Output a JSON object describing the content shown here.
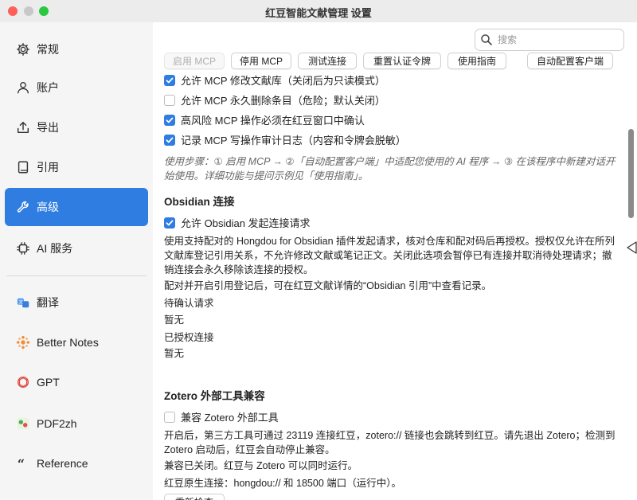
{
  "window": {
    "title": "红豆智能文献管理 设置"
  },
  "search": {
    "placeholder": "搜索"
  },
  "sidebar": {
    "items": [
      {
        "label": "常规",
        "icon": "gear-icon"
      },
      {
        "label": "账户",
        "icon": "person-icon"
      },
      {
        "label": "导出",
        "icon": "export-icon"
      },
      {
        "label": "引用",
        "icon": "book-icon"
      },
      {
        "label": "高级",
        "icon": "wrench-icon",
        "active": true
      },
      {
        "label": "AI 服务",
        "icon": "chip-icon"
      },
      {
        "label": "翻译",
        "icon": "translate-icon"
      },
      {
        "label": "Better Notes",
        "icon": "sparkle-icon"
      },
      {
        "label": "GPT",
        "icon": "openai-icon"
      },
      {
        "label": "PDF2zh",
        "icon": "pdf2zh-icon"
      },
      {
        "label": "Reference",
        "icon": "quote-icon"
      }
    ]
  },
  "mcp": {
    "buttons": {
      "enable": "启用 MCP",
      "disable": "停用 MCP",
      "test": "测试连接",
      "reset_token": "重置认证令牌",
      "guide": "使用指南",
      "auto_config": "自动配置客户端"
    },
    "options": [
      {
        "label": "允许 MCP 修改文献库（关闭后为只读模式）",
        "checked": true
      },
      {
        "label": "允许 MCP 永久删除条目（危险；默认关闭）",
        "checked": false
      },
      {
        "label": "高风险 MCP 操作必须在红豆窗口中确认",
        "checked": true
      },
      {
        "label": "记录 MCP 写操作审计日志（内容和令牌会脱敏）",
        "checked": true
      }
    ],
    "hint": "使用步骤：① 启用 MCP → ②「自动配置客户端」中适配您使用的 AI 程序 → ③ 在该程序中新建对话开始使用。详细功能与提问示例见「使用指南」。"
  },
  "obsidian": {
    "title": "Obsidian 连接",
    "allow_label": "允许 Obsidian 发起连接请求",
    "allow_checked": true,
    "description": "使用支持配对的 Hongdou for Obsidian 插件发起请求，核对仓库和配对码后再授权。授权仅允许在所列文献库登记引用关系，不允许修改文献或笔记正文。关闭此选项会暂停已有连接并取消待处理请求；撤销连接会永久移除该连接的授权。",
    "note": "配对并开启引用登记后，可在红豆文献详情的“Obsidian 引用”中查看记录。",
    "pending_label": "待确认请求",
    "pending_value": "暂无",
    "authorized_label": "已授权连接",
    "authorized_value": "暂无"
  },
  "zotero": {
    "title": "Zotero 外部工具兼容",
    "compat_label": "兼容 Zotero 外部工具",
    "compat_checked": false,
    "description": "开启后，第三方工具可通过 23119 连接红豆，zotero:// 链接也会跳转到红豆。请先退出 Zotero；检测到 Zotero 启动后，红豆会自动停止兼容。",
    "status": "兼容已关闭。红豆与 Zotero 可以同时运行。",
    "native": "红豆原生连接：hongdou:// 和 18500 端口（运行中）。",
    "recheck": "重新检查"
  },
  "colors": {
    "accent": "#2f7de1"
  }
}
